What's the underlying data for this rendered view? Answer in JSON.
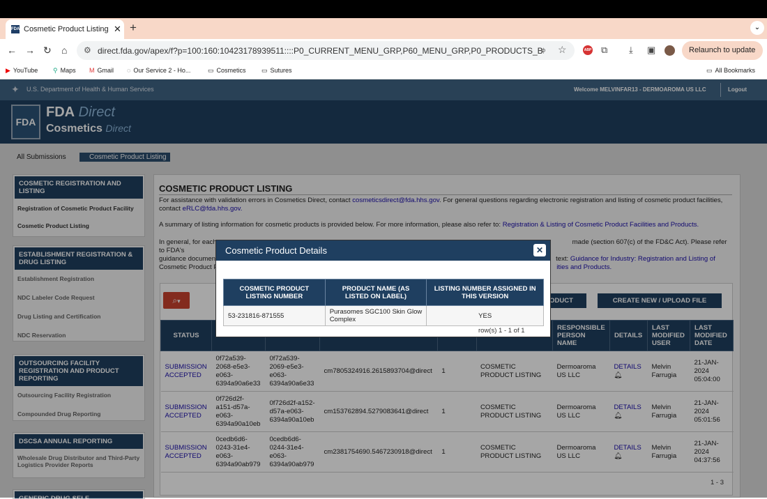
{
  "browser": {
    "tab_title": "Cosmetic Product Listing",
    "favicon_text": "FDA",
    "url": "direct.fda.gov/apex/f?p=100:160:10423178939511::::P0_CURRENT_MENU_GRP,P60_MENU_GRP,P0_PRODUCTS_BREADCRUMB...",
    "abp_label": "ABP",
    "relaunch_label": "Relaunch to update",
    "bookmarks": [
      "YouTube",
      "Maps",
      "Gmail",
      "Our Service 2 - Ho...",
      "Cosmetics",
      "Sutures"
    ],
    "all_bookmarks": "All Bookmarks"
  },
  "hhs": {
    "dept": "U.S. Department of Health & Human Services",
    "welcome": "Welcome MELVINFAR13 - DERMOAROMA US LLC",
    "logout": "Logout"
  },
  "banner": {
    "logo": "FDA",
    "fda": "FDA",
    "direct": "Direct",
    "cosmetics": "Cosmetics",
    "direct2": "Direct"
  },
  "breadcrumb": {
    "item1": "All Submissions",
    "item2": "Cosmetic Product Listing"
  },
  "sidebar": {
    "sec1": {
      "title": "COSMETIC REGISTRATION AND LISTING",
      "links": [
        "Registration of Cosmetic Product Facility",
        "Cosmetic Product Listing"
      ]
    },
    "sec2": {
      "title": "ESTABLISHMENT REGISTRATION & DRUG LISTING",
      "links": [
        "Establishment Registration",
        "NDC Labeler Code Request",
        "Drug Listing and Certification",
        "NDC Reservation"
      ]
    },
    "sec3": {
      "title": "OUTSOURCING FACILITY REGISTRATION AND PRODUCT REPORTING",
      "links": [
        "Outsourcing Facility Registration",
        "Compounded Drug Reporting"
      ]
    },
    "sec4": {
      "title": "DSCSA ANNUAL REPORTING",
      "links": [
        "Wholesale Drug Distributor and Third-Party Logistics Provider Reports"
      ]
    },
    "sec5": {
      "title": "GENERIC DRUG SELF"
    }
  },
  "main": {
    "title": "COSMETIC PRODUCT LISTING",
    "p1_a": "For assistance with validation errors in Cosmetics Direct, contact ",
    "p1_link": "cosmeticsdirect@fda.hhs.gov",
    "p1_b": ". For general questions regarding electronic registration and listing of cosmetic product facilities, contact ",
    "p1_link2": "eRLC@fda.hhs.gov.",
    "p2_a": "A summary of listing information for cosmetic products is provided below. For more information, please also refer to: ",
    "p2_link": "Registration & Listing of Cosmetic Product Facilities and Products.",
    "p3_a": "In general, for each",
    "p3_b": "made (section 607(c) of the FD&C Act). Please refer to FDA's",
    "p3_c": "guidance documen",
    "p3_d": "text: ",
    "p3_link": "Guidance for Industry: Registration and Listing of",
    "p3_e": "Cosmetic Product F",
    "p3_link2": "ities and Products.",
    "btn_product": "ODUCT",
    "btn_create": "CREATE NEW / UPLOAD FILE",
    "columns": [
      "STATUS",
      "",
      "",
      "",
      "",
      "",
      "RESPONSIBLE PERSON NAME",
      "DETAILS",
      "LAST MODIFIED USER",
      "LAST MODIFIED DATE"
    ],
    "rows": [
      {
        "status": "SUBMISSION ACCEPTED",
        "id1": "0f72a539-2068-e5e3-e063-6394a90a6e33",
        "id2": "0f72a539-2069-e5e3-e063-6394a90a6e33",
        "ref": "cm7805324916.2615893704@direct",
        "version": "1",
        "type": "COSMETIC PRODUCT LISTING",
        "person": "Dermoaroma US LLC",
        "details": "DETAILS",
        "user": "Melvin Farrugia",
        "date": "21-JAN-2024 05:04:00"
      },
      {
        "status": "SUBMISSION ACCEPTED",
        "id1": "0f726d2f-a151-d57a-e063-6394a90a10eb",
        "id2": "0f726d2f-a152-d57a-e063-6394a90a10eb",
        "ref": "cm153762894.5279083641@direct",
        "version": "1",
        "type": "COSMETIC PRODUCT LISTING",
        "person": "Dermoaroma US LLC",
        "details": "DETAILS",
        "user": "Melvin Farrugia",
        "date": "21-JAN-2024 05:01:56"
      },
      {
        "status": "SUBMISSION ACCEPTED",
        "id1": "0cedb6d6-0243-31e4-e063-6394a90ab979",
        "id2": "0cedb6d6-0244-31e4-e063-6394a90ab979",
        "ref": "cm2381754690.5467230918@direct",
        "version": "1",
        "type": "COSMETIC PRODUCT LISTING",
        "person": "Dermoaroma US LLC",
        "details": "DETAILS",
        "user": "Melvin Farrugia",
        "date": "21-JAN-2024 04:37:56"
      }
    ],
    "pagination": "1 - 3"
  },
  "modal": {
    "title": "Cosmetic Product Details",
    "col1": "COSMETIC PRODUCT LISTING NUMBER",
    "col2": "PRODUCT NAME (AS LISTED ON LABEL)",
    "col3": "LISTING NUMBER ASSIGNED IN THIS VERSION",
    "listing_number": "53-231816-871555",
    "product_name": "Purasomes SGC100 Skin Glow Complex",
    "assigned": "YES",
    "rows_label": "row(s) 1 - 1 of 1"
  }
}
